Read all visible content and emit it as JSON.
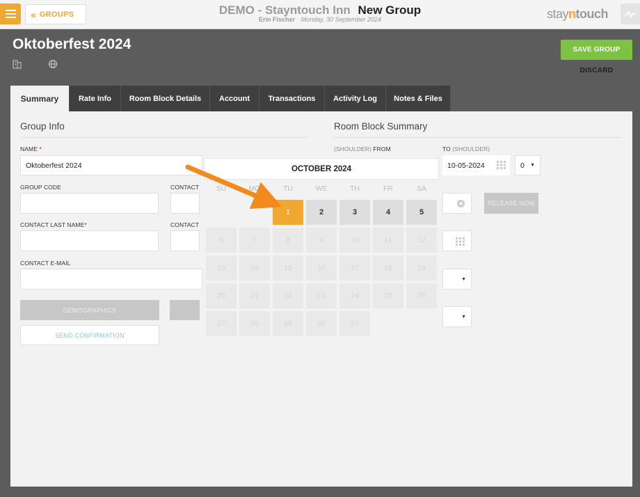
{
  "header": {
    "back_label": "GROUPS",
    "hotel": "DEMO - Stayntouch Inn",
    "page_title": "New Group",
    "user": "Erin Fischer",
    "date": "Monday, 30 September 2024",
    "logo": {
      "a": "stay",
      "n": "n",
      "b": "touch"
    }
  },
  "group": {
    "name": "Oktoberfest 2024",
    "save_label": "SAVE GROUP",
    "discard_label": "DISCARD"
  },
  "tabs": [
    {
      "label": "Summary",
      "active": true
    },
    {
      "label": "Rate Info"
    },
    {
      "label": "Room Block Details"
    },
    {
      "label": "Account"
    },
    {
      "label": "Transactions"
    },
    {
      "label": "Activity Log"
    },
    {
      "label": "Notes & Files"
    }
  ],
  "group_info": {
    "title": "Group Info",
    "name_label": "NAME",
    "name_value": "Oktoberfest 2024",
    "group_code_label": "GROUP CODE",
    "contact_label_1": "CONTACT",
    "contact_last_label": "CONTACT LAST NAME",
    "contact_label_2": "CONTACT",
    "contact_email_label": "CONTACT E-MAIL",
    "demographics_label": "DEMOGRAPHICS",
    "send_confirmation_label": "SEND CONFIRMATION"
  },
  "room_block": {
    "title": "Room Block Summary",
    "from_label_light": "(SHOULDER)",
    "from_label": "FROM",
    "to_label": "TO",
    "to_label_light": "(SHOULDER)",
    "to_value": "10-05-2024",
    "shoulder_value": "0",
    "release_label": "RELEASE NOW"
  },
  "calendar": {
    "month": "OCTOBER 2024",
    "days": [
      "SU",
      "MO",
      "TU",
      "WE",
      "TH",
      "FR",
      "SA"
    ],
    "first_dow": 2,
    "num_days": 31,
    "selected": 1,
    "enabled": [
      1,
      2,
      3,
      4,
      5
    ]
  },
  "colors": {
    "accent": "#f0a830",
    "save": "#7dc242",
    "annotation_arrow": "#f28a1e"
  }
}
